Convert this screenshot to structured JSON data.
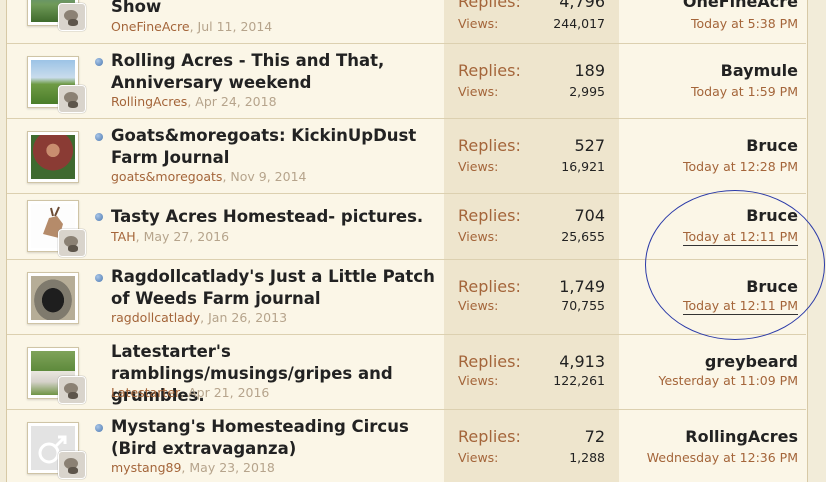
{
  "threads": [
    {
      "title": "Show",
      "author": "OneFineAcre",
      "date": "Jul 11, 2014",
      "replies_label": "Replies:",
      "replies": "4,796",
      "views_label": "Views:",
      "views": "244,017",
      "last_user": "OneFineAcre",
      "last_time": "Today at 5:38 PM",
      "unread_dot": false
    },
    {
      "title": "Rolling Acres - This and That, Anniversary weekend",
      "author": "RollingAcres",
      "date": "Apr 24, 2018",
      "replies_label": "Replies:",
      "replies": "189",
      "views_label": "Views:",
      "views": "2,995",
      "last_user": "Baymule",
      "last_time": "Today at 1:59 PM",
      "unread_dot": true
    },
    {
      "title": "Goats&moregoats: KickinUpDust Farm Journal",
      "author": "goats&moregoats",
      "date": "Nov 9, 2014",
      "replies_label": "Replies:",
      "replies": "527",
      "views_label": "Views:",
      "views": "16,921",
      "last_user": "Bruce",
      "last_time": "Today at 12:28 PM",
      "unread_dot": true
    },
    {
      "title": "Tasty Acres Homestead- pictures.",
      "author": "TAH",
      "date": "May 27, 2016",
      "replies_label": "Replies:",
      "replies": "704",
      "views_label": "Views:",
      "views": "25,655",
      "last_user": "Bruce",
      "last_time": "Today at 12:11 PM",
      "unread_dot": true
    },
    {
      "title": "Ragdollcatlady's Just a Little Patch of Weeds Farm journal",
      "author": "ragdollcatlady",
      "date": "Jan 26, 2013",
      "replies_label": "Replies:",
      "replies": "1,749",
      "views_label": "Views:",
      "views": "70,755",
      "last_user": "Bruce",
      "last_time": "Today at 12:11 PM",
      "unread_dot": true
    },
    {
      "title": "Latestarter's ramblings/musings/gripes and grumbles.",
      "author": "Latestarter",
      "date": "Apr 21, 2016",
      "replies_label": "Replies:",
      "replies": "4,913",
      "views_label": "Views:",
      "views": "122,261",
      "last_user": "greybeard",
      "last_time": "Yesterday at 11:09 PM",
      "unread_dot": false
    },
    {
      "title": "Mystang's Homesteading Circus (Bird extravaganza)",
      "author": "mystang89",
      "date": "May 23, 2018",
      "replies_label": "Replies:",
      "replies": "72",
      "views_label": "Views:",
      "views": "1,288",
      "last_user": "RollingAcres",
      "last_time": "Wednesday at 12:36 PM",
      "unread_dot": true
    }
  ],
  "colors": {
    "background": "#fbf6e7",
    "stats_background": "#eee5cd",
    "link_brown": "#a4653a",
    "unread_dot": "#4c78b0",
    "annotation_ellipse": "#2b3aa8"
  }
}
